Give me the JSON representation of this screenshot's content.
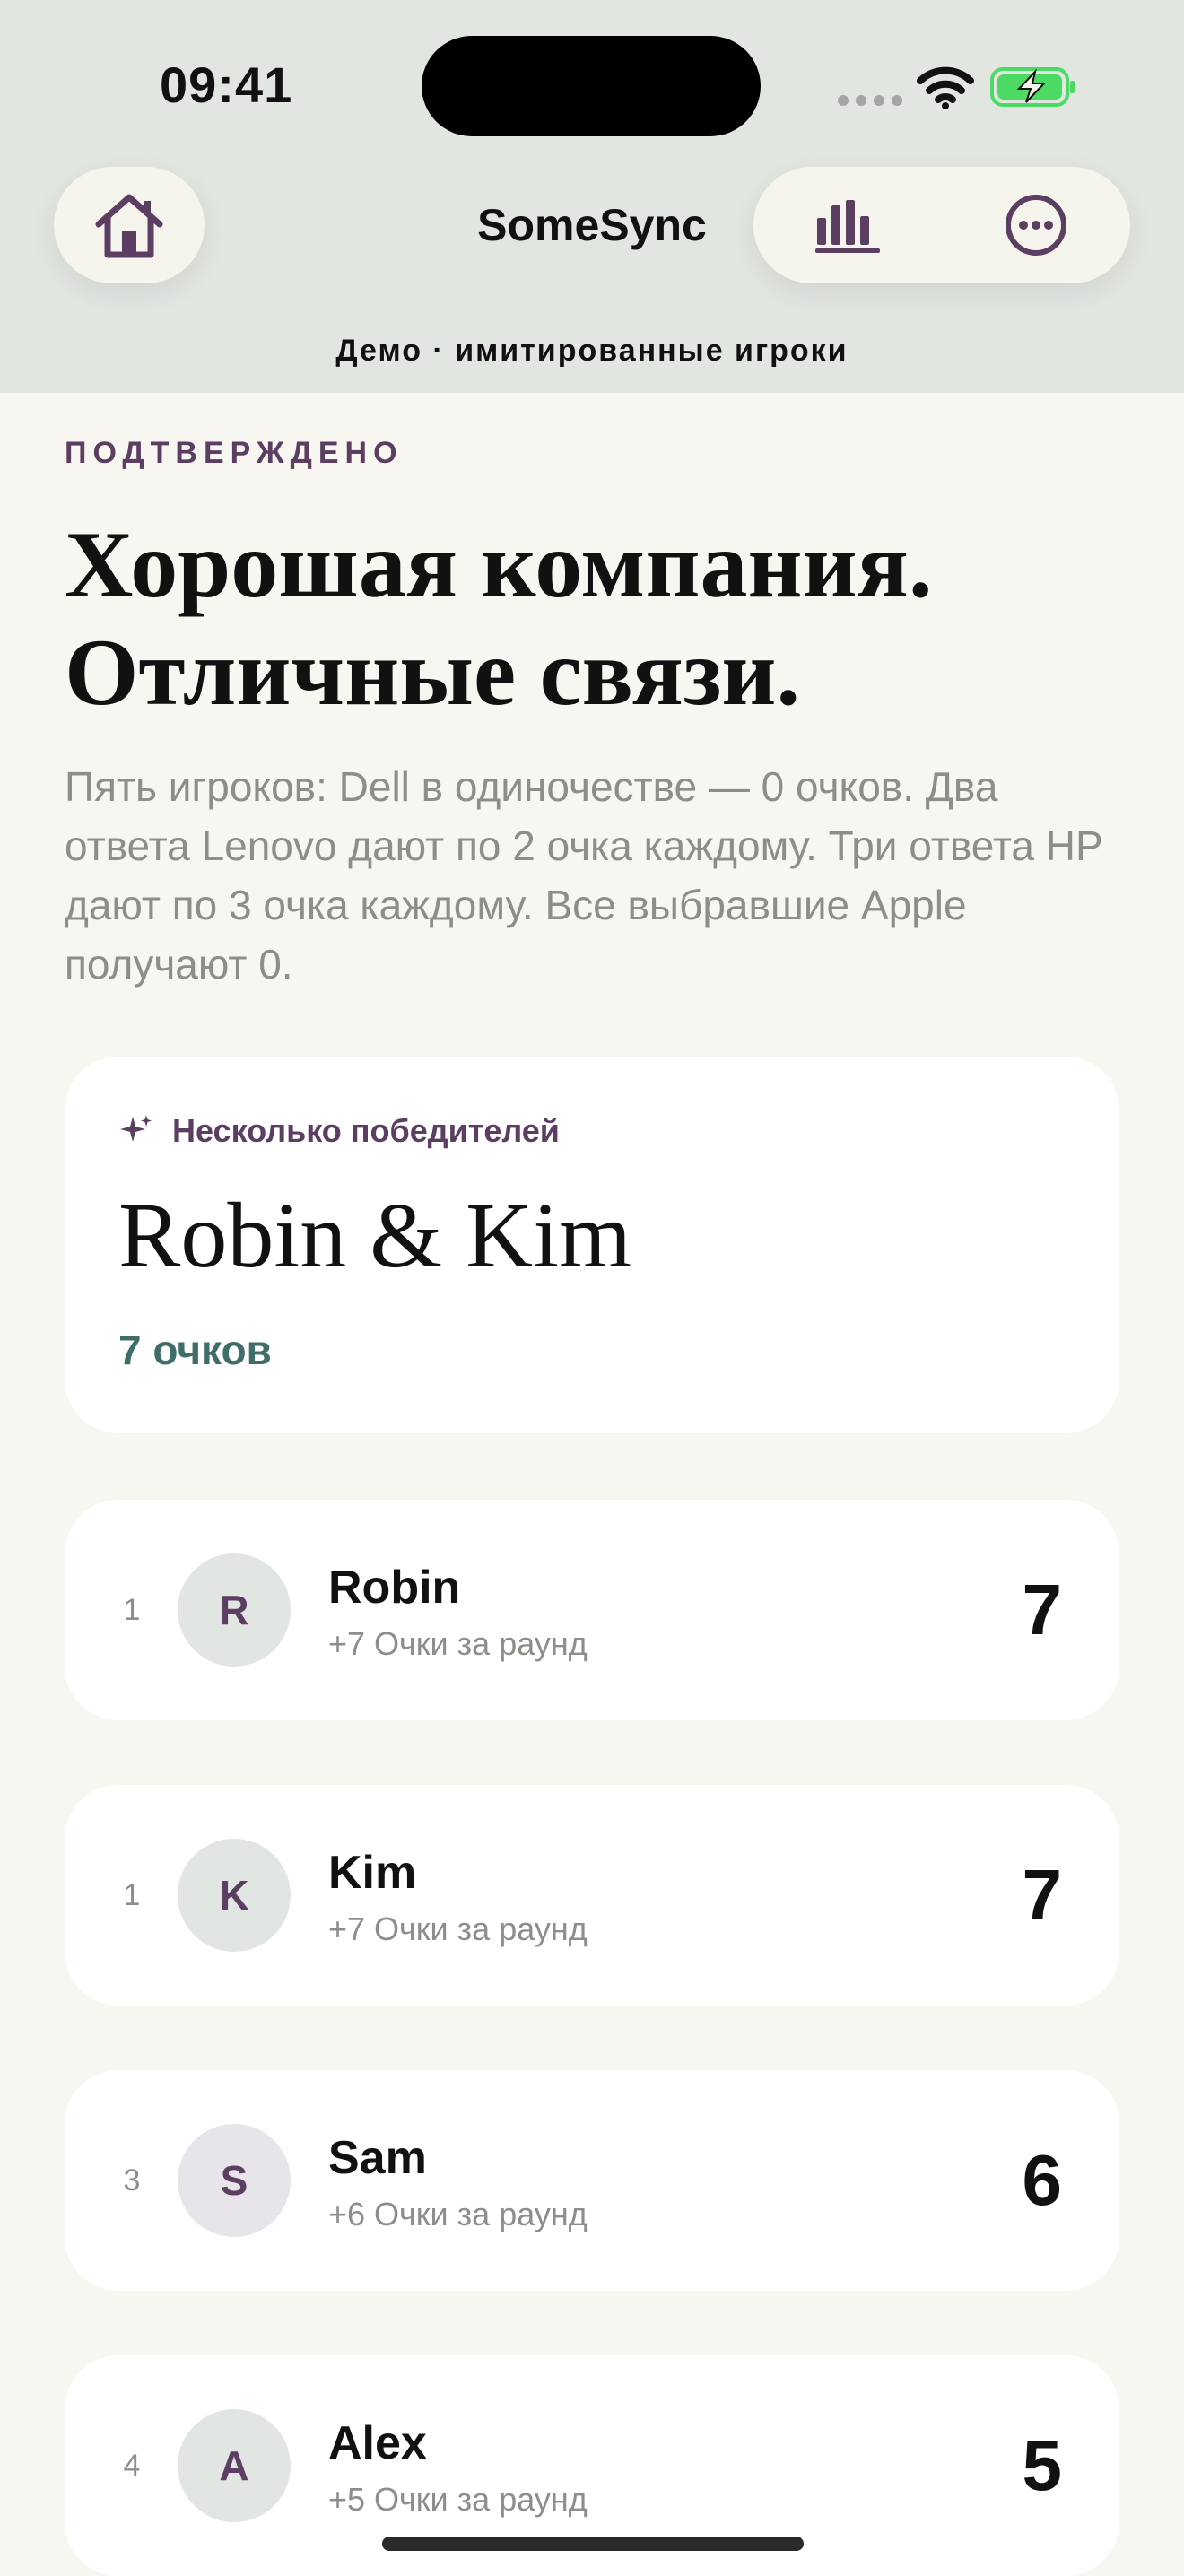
{
  "status_bar": {
    "time": "09:41"
  },
  "header": {
    "title": "SomeSync",
    "mode_label": "Демо · имитированные игроки",
    "icons": {
      "home": "home-icon",
      "chart": "bar-chart-icon",
      "more": "more-icon"
    }
  },
  "result": {
    "eyebrow": "ПОДТВЕРЖДЕНО",
    "headline_line1": "Хорошая компания.",
    "headline_line2": "Отличные связи.",
    "description": "Пять игроков: Dell в одиночестве — 0 очков. Два ответа Lenovo дают по 2 очка каждому. Три ответа HP дают по 3 очка каждому. Все выбравшие Apple получают 0."
  },
  "winner": {
    "tag": "Несколько победителей",
    "names": "Robin & Kim",
    "points": "7 очков",
    "icon": "sparkle-icon"
  },
  "leaderboard": [
    {
      "rank": "1",
      "initial": "R",
      "name": "Robin",
      "subtitle": "+7 Очки за раунд",
      "score": "7",
      "avatar_color": "#e2e6e2"
    },
    {
      "rank": "1",
      "initial": "K",
      "name": "Kim",
      "subtitle": "+7 Очки за раунд",
      "score": "7",
      "avatar_color": "#e2e6e2"
    },
    {
      "rank": "3",
      "initial": "S",
      "name": "Sam",
      "subtitle": "+6 Очки за раунд",
      "score": "6",
      "avatar_color": "#e7e4ea"
    },
    {
      "rank": "4",
      "initial": "A",
      "name": "Alex",
      "subtitle": "+5 Очки за раунд",
      "score": "5",
      "avatar_color": "#e2e6e2"
    }
  ],
  "colors": {
    "accent": "#5b3e62",
    "points_green": "#3f6e6a",
    "battery_green": "#4cd964",
    "header_bg": "#e2e6e1",
    "page_bg": "#f8f6f0"
  }
}
